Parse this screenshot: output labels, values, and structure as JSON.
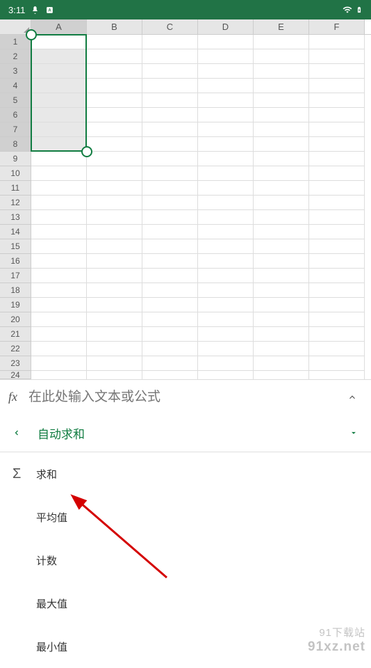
{
  "status": {
    "time": "3:11"
  },
  "columns": [
    "A",
    "B",
    "C",
    "D",
    "E",
    "F"
  ],
  "rows": [
    "1",
    "2",
    "3",
    "4",
    "5",
    "6",
    "7",
    "8",
    "9",
    "10",
    "11",
    "12",
    "13",
    "14",
    "15",
    "16",
    "17",
    "18",
    "19",
    "20",
    "21",
    "22",
    "23",
    "24"
  ],
  "selection": {
    "startRow": 1,
    "endRow": 8,
    "col": "A"
  },
  "formula": {
    "fx": "fx",
    "placeholder": "在此处输入文本或公式"
  },
  "menu": {
    "title": "自动求和",
    "items": [
      {
        "icon": "Σ",
        "label": "求和"
      },
      {
        "icon": "",
        "label": "平均值"
      },
      {
        "icon": "",
        "label": "计数"
      },
      {
        "icon": "",
        "label": "最大值"
      },
      {
        "icon": "",
        "label": "最小值"
      }
    ]
  },
  "watermark": {
    "line1": "91下载站",
    "line2": "91xz.net"
  },
  "colors": {
    "brand": "#217346",
    "accent": "#107C41"
  }
}
